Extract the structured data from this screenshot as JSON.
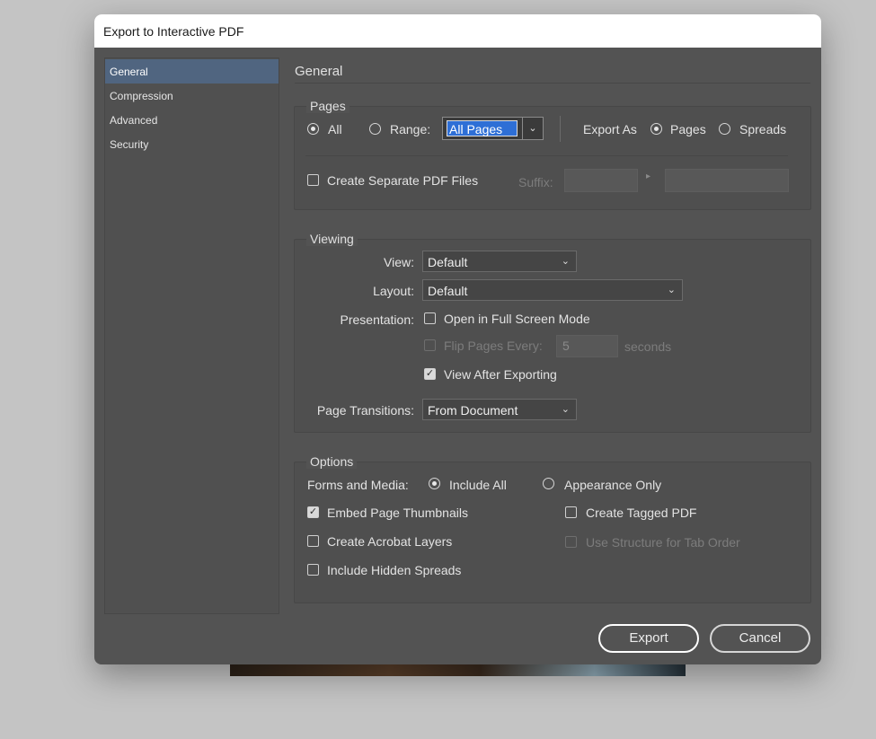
{
  "window": {
    "title": "Export to Interactive PDF"
  },
  "sidebar": {
    "items": [
      {
        "label": "General",
        "selected": true
      },
      {
        "label": "Compression",
        "selected": false
      },
      {
        "label": "Advanced",
        "selected": false
      },
      {
        "label": "Security",
        "selected": false
      }
    ]
  },
  "main": {
    "section_title": "General"
  },
  "pages": {
    "legend": "Pages",
    "all_label": "All",
    "range_label": "Range:",
    "range_value": "All Pages",
    "export_as_label": "Export As",
    "pages_label": "Pages",
    "spreads_label": "Spreads",
    "separate_pdf_label": "Create Separate PDF Files",
    "suffix_label": "Suffix:",
    "suffix_value": "",
    "suffix_example": ""
  },
  "viewing": {
    "legend": "Viewing",
    "view_label": "View:",
    "view_value": "Default",
    "layout_label": "Layout:",
    "layout_value": "Default",
    "presentation_label": "Presentation:",
    "full_screen_label": "Open in Full Screen Mode",
    "flip_label": "Flip Pages Every:",
    "flip_value": "5",
    "seconds_label": "seconds",
    "view_after_label": "View After Exporting",
    "transitions_label": "Page Transitions:",
    "transitions_value": "From Document"
  },
  "options": {
    "legend": "Options",
    "forms_label": "Forms and Media:",
    "include_all_label": "Include All",
    "appearance_only_label": "Appearance Only",
    "embed_thumbnails_label": "Embed Page Thumbnails",
    "tagged_pdf_label": "Create Tagged PDF",
    "acrobat_layers_label": "Create Acrobat Layers",
    "tab_order_label": "Use Structure for Tab Order",
    "hidden_spreads_label": "Include Hidden Spreads"
  },
  "footer": {
    "export_label": "Export",
    "cancel_label": "Cancel"
  },
  "colors": {
    "dialog_bg": "#535353",
    "selection": "#506580",
    "range_highlight": "#2e6fd6"
  },
  "icons": {
    "chevron": "chevron-down-icon",
    "arrow": "triangle-right-icon"
  }
}
